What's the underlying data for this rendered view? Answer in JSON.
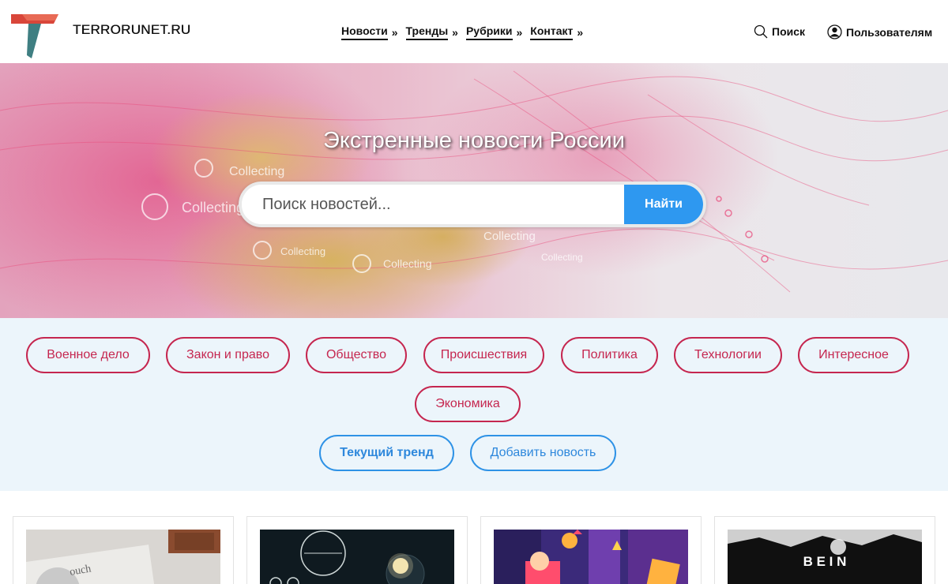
{
  "header": {
    "site_name": "TERRORUNET.RU",
    "nav": [
      {
        "label": "Новости",
        "arrow": "»"
      },
      {
        "label": "Тренды",
        "arrow": "»"
      },
      {
        "label": "Рубрики",
        "arrow": "»"
      },
      {
        "label": "Контакт",
        "arrow": "»"
      }
    ],
    "search_label": "Поиск",
    "users_label": "Пользователям"
  },
  "hero": {
    "title": "Экстренные новости России",
    "search_placeholder": "Поиск новостей...",
    "search_button": "Найти",
    "overlay_word": "Collecting"
  },
  "categories": [
    "Военное дело",
    "Закон и право",
    "Общество",
    "Происшествия",
    "Политика",
    "Технологии",
    "Интересное",
    "Экономика"
  ],
  "actions": {
    "trend": "Текущий тренд",
    "add_news": "Добавить новость"
  },
  "cards": [
    {
      "image": "tablet-on-wood-photo",
      "caption": "ouch"
    },
    {
      "image": "space-dashboard-illustration",
      "caption": ""
    },
    {
      "image": "colorful-flat-illustration",
      "caption": ""
    },
    {
      "image": "mountain-sunrise-photo",
      "caption": "B E I N"
    }
  ],
  "colors": {
    "accent_red": "#c5264f",
    "accent_blue": "#2e98f0",
    "category_bg": "#ecf5fb"
  }
}
